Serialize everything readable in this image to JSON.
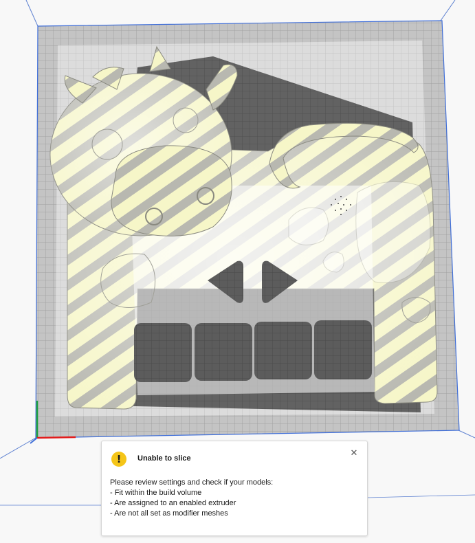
{
  "viewport": {
    "plate_color": "#b2b2b2",
    "build_area_color": "#c2c2c2",
    "stripe_light": "#f6f6c8",
    "stripe_dark": "#b4b4ac",
    "cutout_color": "#5a5a5a",
    "axis_x_color": "#e21c1c",
    "axis_y_color": "#1e9f3e",
    "volume_edge_color": "#3f6ed8"
  },
  "notification": {
    "icon": "warning-icon",
    "title": "Unable to slice",
    "close_icon": "close-icon",
    "message_intro": "Please review settings and check if your models:",
    "reasons": [
      "- Fit within the build volume",
      "- Are assigned to an enabled extruder",
      "- Are not all set as modifier meshes"
    ]
  }
}
